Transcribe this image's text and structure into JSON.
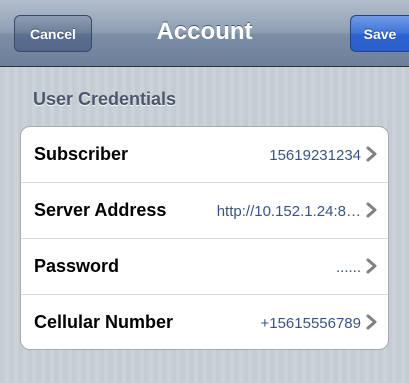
{
  "navbar": {
    "title": "Account",
    "cancel_label": "Cancel",
    "save_label": "Save"
  },
  "section": {
    "header": "User Credentials",
    "rows": [
      {
        "label": "Subscriber",
        "value": "15619231234"
      },
      {
        "label": "Server Address",
        "value": "http://10.152.1.24:8…"
      },
      {
        "label": "Password",
        "value": "......"
      },
      {
        "label": "Cellular Number",
        "value": "+15615556789"
      }
    ]
  },
  "colors": {
    "navbar": "#8d9db2",
    "save_button": "#3f73d8",
    "value_text": "#385487",
    "background": "#c5ccd4"
  },
  "icons": {
    "row_disclosure": "chevron-right-icon"
  }
}
